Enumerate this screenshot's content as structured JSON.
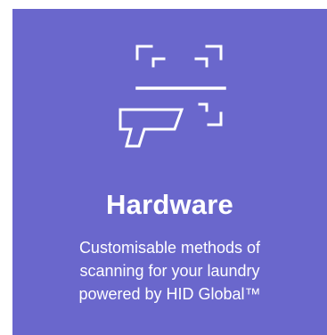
{
  "card": {
    "title": "Hardware",
    "description": "Customisable methods of scanning for your laundry powered by HID Global™",
    "icon": "barcode-scanner-icon",
    "background_color": "#6a67cc",
    "text_color": "#ffffff"
  }
}
